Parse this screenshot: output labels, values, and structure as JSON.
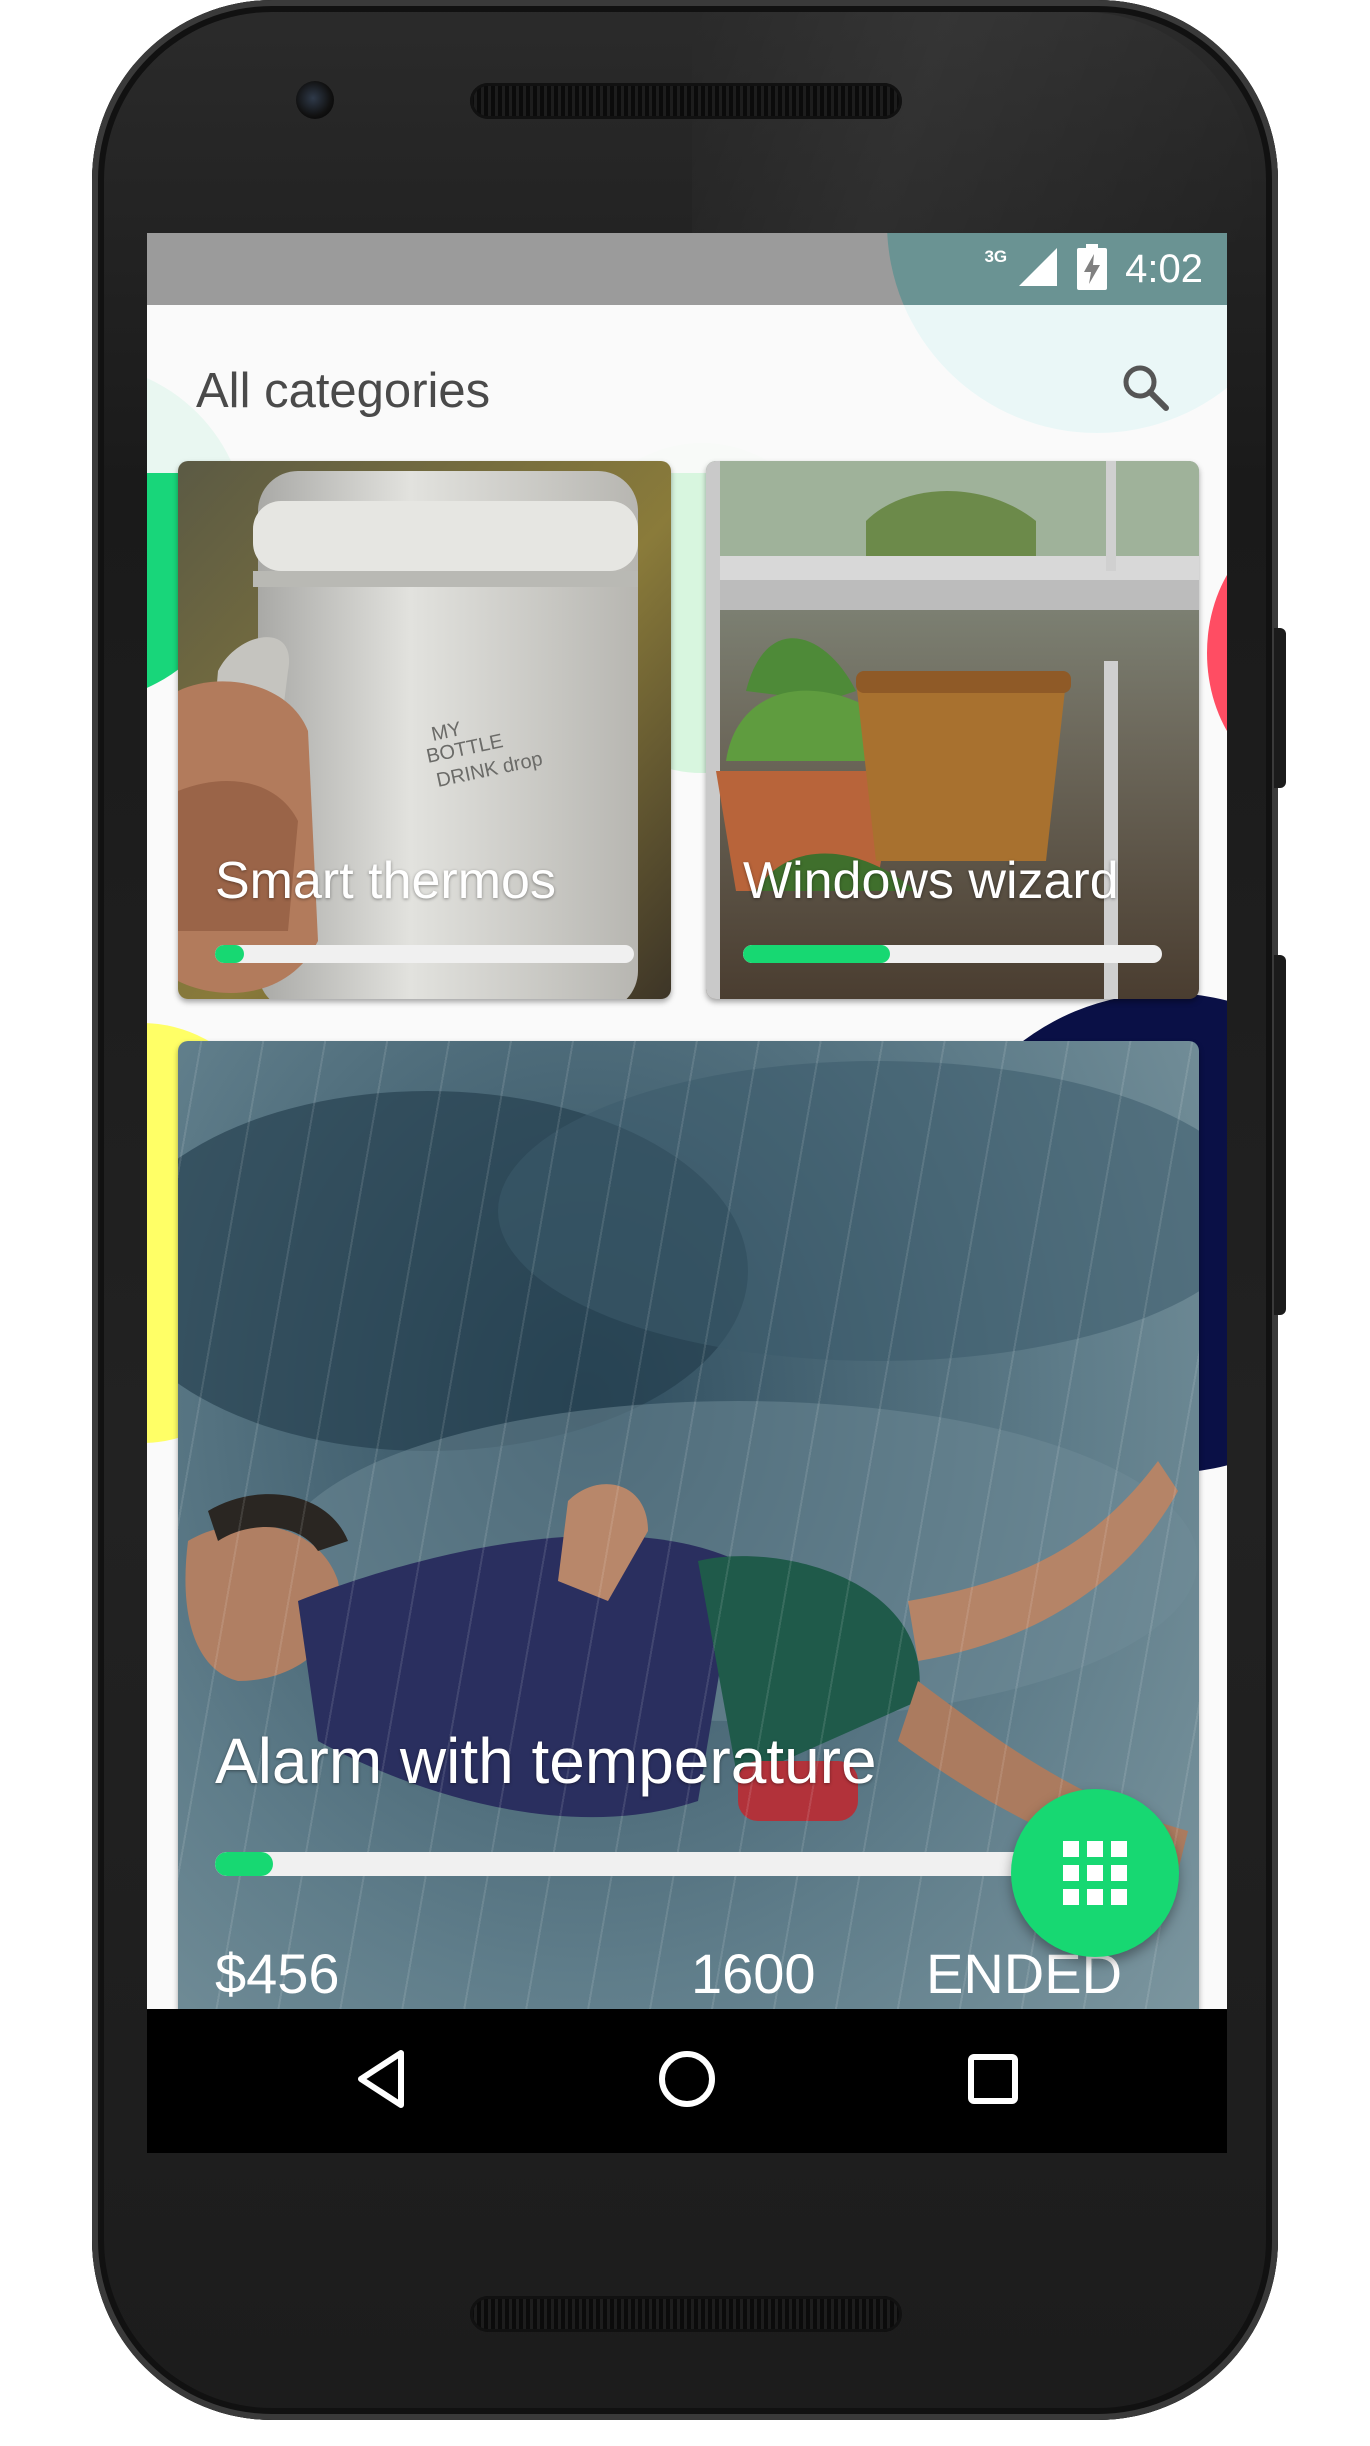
{
  "status_bar": {
    "network": "3G",
    "time": "4:02",
    "icons": [
      "signal-icon",
      "battery-charging-icon"
    ]
  },
  "toolbar": {
    "title": "All categories",
    "search_icon": "search-icon"
  },
  "cards": [
    {
      "title": "Smart thermos",
      "progress": 0.07,
      "image": "thermos-photo"
    },
    {
      "title": "Windows wizard",
      "progress": 0.35,
      "image": "window-plants-photo"
    },
    {
      "title": "Alarm with temperature",
      "progress": 0.07,
      "image": "man-in-rain-photo",
      "price": "$456",
      "count": "1600",
      "status": "ENDED"
    }
  ],
  "fab": {
    "icon": "apps-grid-icon"
  },
  "nav_bar": {
    "back_icon": "back-triangle-icon",
    "home_icon": "home-circle-icon",
    "recent_icon": "recent-apps-square-icon"
  },
  "colors": {
    "accent": "#17d872",
    "teal": "#1fd6d6",
    "navy": "#0a1046",
    "red": "#ff4d63",
    "yellow": "#ffff66",
    "status_bar": "#808080",
    "nav_bar": "#000000"
  }
}
